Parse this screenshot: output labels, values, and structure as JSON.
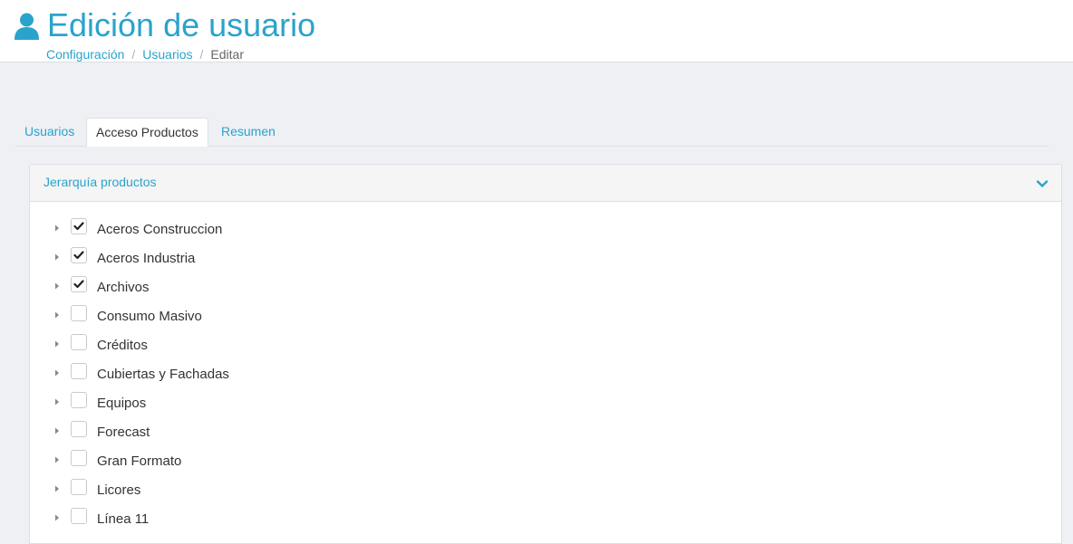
{
  "header": {
    "title": "Edición de usuario",
    "icon": "user-icon",
    "accent_color": "#2aa3cc",
    "breadcrumb": {
      "items": [
        "Configuración",
        "Usuarios"
      ],
      "current": "Editar",
      "separator": "/"
    }
  },
  "tabs": [
    {
      "label": "Usuarios",
      "active": false
    },
    {
      "label": "Acceso Productos",
      "active": true
    },
    {
      "label": "Resumen",
      "active": false
    }
  ],
  "panel": {
    "title": "Jerarquía productos",
    "toggle_icon": "chevron-down-icon",
    "items": [
      {
        "label": "Aceros Construccion",
        "checked": true
      },
      {
        "label": "Aceros Industria",
        "checked": true
      },
      {
        "label": "Archivos",
        "checked": true
      },
      {
        "label": "Consumo Masivo",
        "checked": false
      },
      {
        "label": "Créditos",
        "checked": false
      },
      {
        "label": "Cubiertas y Fachadas",
        "checked": false
      },
      {
        "label": "Equipos",
        "checked": false
      },
      {
        "label": "Forecast",
        "checked": false
      },
      {
        "label": "Gran Formato",
        "checked": false
      },
      {
        "label": "Licores",
        "checked": false
      },
      {
        "label": "Línea 11",
        "checked": false
      }
    ]
  }
}
